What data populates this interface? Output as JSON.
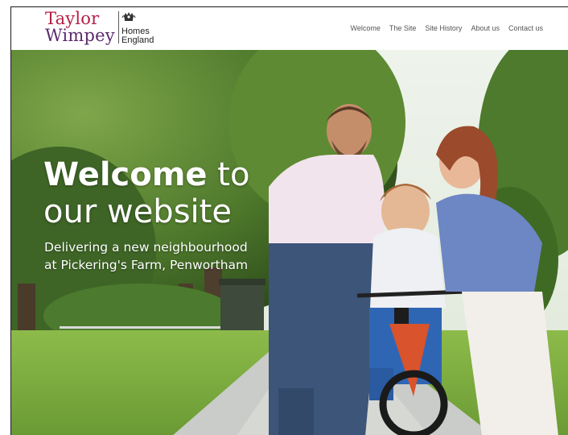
{
  "header": {
    "logo_taylor_wimpey": [
      "Taylor",
      "Wimpey"
    ],
    "logo_homes_england": [
      "Homes",
      "England"
    ]
  },
  "nav": {
    "items": [
      {
        "label": "Welcome"
      },
      {
        "label": "The Site"
      },
      {
        "label": "Site History"
      },
      {
        "label": "About us"
      },
      {
        "label": "Contact us"
      }
    ]
  },
  "hero": {
    "title_bold": "Welcome",
    "title_rest": "to",
    "title_line2": "our website",
    "subtitle_line1": "Delivering a new neighbourhood",
    "subtitle_line2": "at Pickering's Farm, Penwortham"
  },
  "colors": {
    "taylor": "#b41f45",
    "wimpey": "#5b2a6e",
    "nav_text": "#555555"
  }
}
